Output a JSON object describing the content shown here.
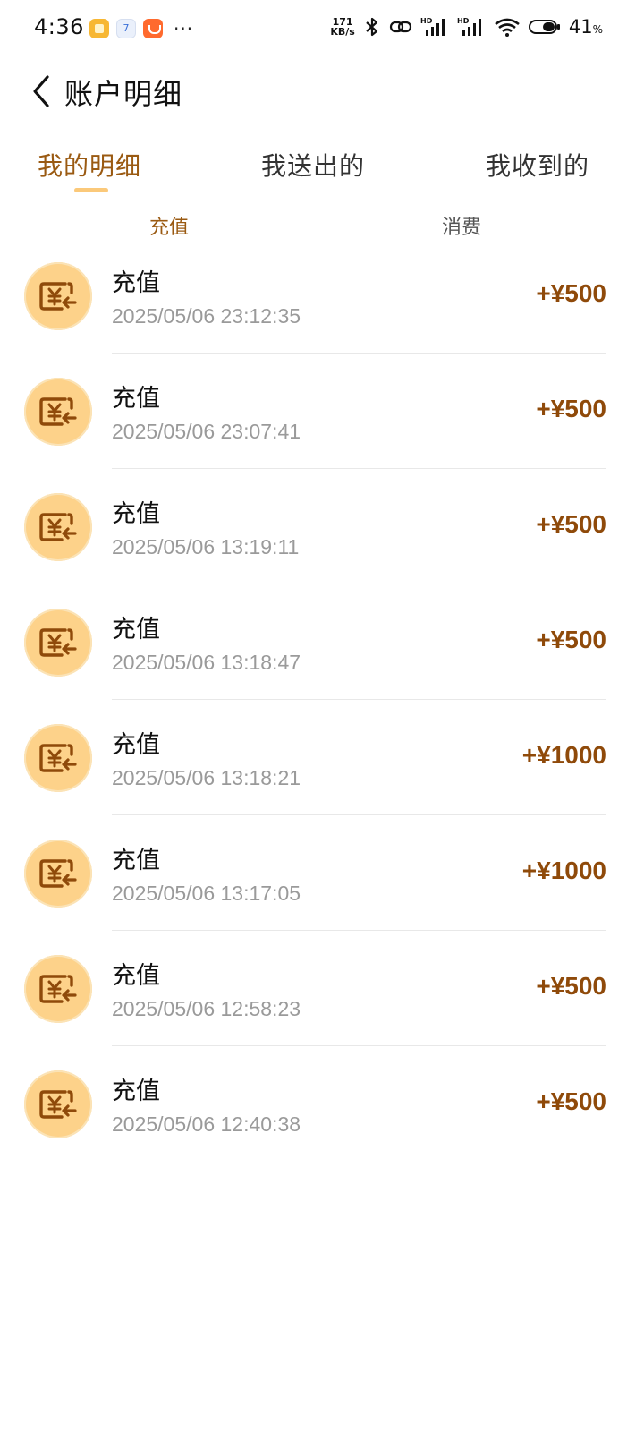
{
  "status": {
    "time": "4:36",
    "app2_label": "7",
    "more": "···",
    "netspeed_value": "171",
    "netspeed_unit": "KB/s",
    "battery": "41",
    "battery_unit": "%"
  },
  "header": {
    "title": "账户明细"
  },
  "tabs": [
    {
      "label": "我的明细",
      "active": true
    },
    {
      "label": "我送出的",
      "active": false
    },
    {
      "label": "我收到的",
      "active": false
    }
  ],
  "subtabs": [
    {
      "label": "充值",
      "active": true
    },
    {
      "label": "消费",
      "active": false
    }
  ],
  "records": [
    {
      "title": "充值",
      "time": "2025/05/06 23:12:35",
      "amount": "+¥500"
    },
    {
      "title": "充值",
      "time": "2025/05/06 23:07:41",
      "amount": "+¥500"
    },
    {
      "title": "充值",
      "time": "2025/05/06 13:19:11",
      "amount": "+¥500"
    },
    {
      "title": "充值",
      "time": "2025/05/06 13:18:47",
      "amount": "+¥500"
    },
    {
      "title": "充值",
      "time": "2025/05/06 13:18:21",
      "amount": "+¥1000"
    },
    {
      "title": "充值",
      "time": "2025/05/06 13:17:05",
      "amount": "+¥1000"
    },
    {
      "title": "充值",
      "time": "2025/05/06 12:58:23",
      "amount": "+¥500"
    },
    {
      "title": "充值",
      "time": "2025/05/06 12:40:38",
      "amount": "+¥500"
    }
  ],
  "colors": {
    "accent": "#9a5a12",
    "amount": "#8f4a0a",
    "icon_bg": "#fdd28a",
    "indicator": "#fbc97a"
  },
  "icons": {
    "record": "recharge-yuan-icon",
    "back": "chevron-left-icon"
  }
}
